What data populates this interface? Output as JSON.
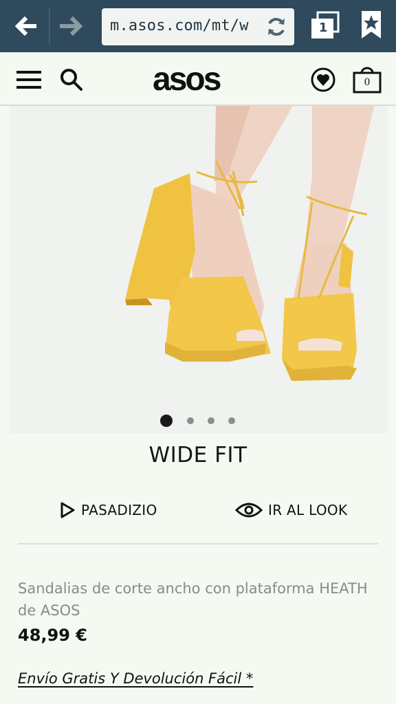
{
  "browser": {
    "url": "m.asos.com/mt/w",
    "tab_count": "1"
  },
  "header": {
    "logo": "asos",
    "bag_count": "0"
  },
  "product": {
    "fit_label": "WIDE FIT",
    "carousel": {
      "total": 4,
      "active": 1
    },
    "actions": {
      "scroll_label": "PASADIZIO",
      "look_label": "IR AL LOOK"
    },
    "name": "Sandalias de corte ancho con plataforma HEATH de ASOS",
    "price": "48,99 €",
    "shipping_link": "Envío Gratis Y Devolución Fácil *"
  },
  "colors": {
    "browser_bar": "#2e4a5c",
    "background": "#f4f9f2",
    "shoe": "#f2c74a"
  }
}
